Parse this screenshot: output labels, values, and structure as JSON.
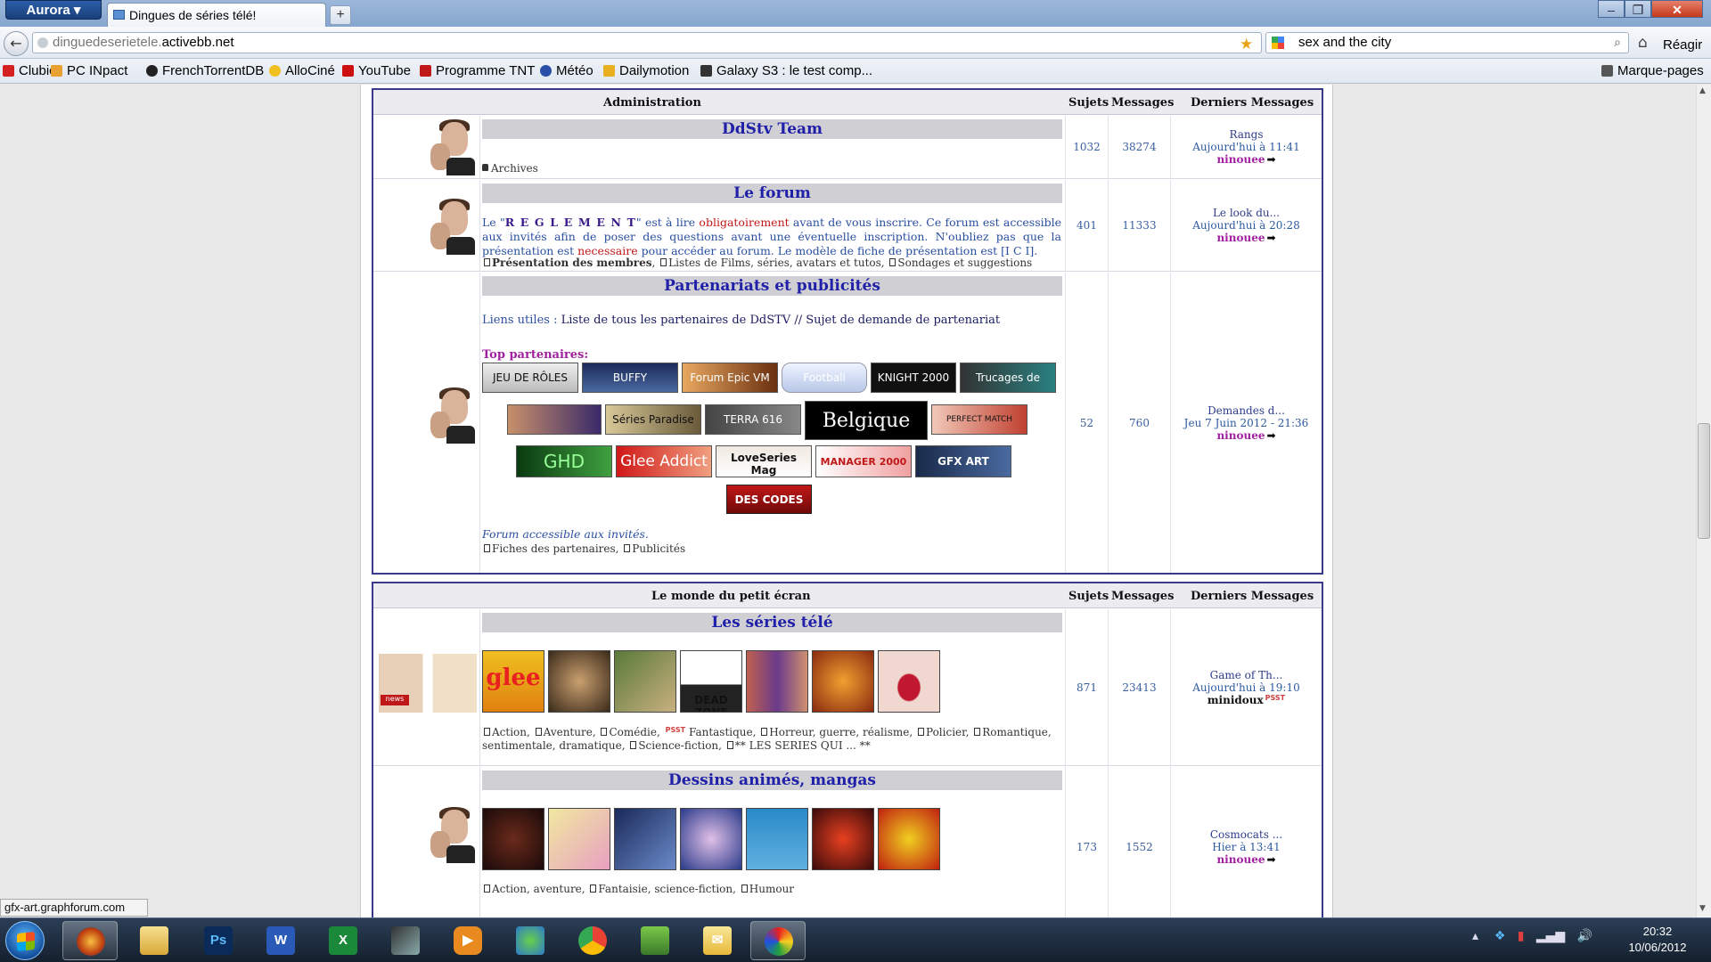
{
  "browser": {
    "app_button": "Aurora",
    "tab_title": "Dingues de séries télé!",
    "new_tab": "+",
    "url_prefix": "dinguedeserietele.",
    "url_host": "activebb.net",
    "search_value": "sex and the city",
    "reagir": "Réagir",
    "bookmarks": [
      "Clubic",
      "PC INpact",
      "FrenchTorrentDB",
      "AlloCiné",
      "YouTube",
      "Programme TNT",
      "Météo",
      "Dailymotion",
      "Galaxy S3 : le test comp..."
    ],
    "bookmarks_menu": "Marque-pages",
    "status_url": "gfx-art.graphforum.com"
  },
  "columns": {
    "sujets": "Sujets",
    "messages": "Messages",
    "derniers": "Derniers Messages"
  },
  "categories": [
    {
      "title": "Administration",
      "forums": [
        {
          "title": "DdStv Team",
          "subforums": [
            "Archives"
          ],
          "sujets": "1032",
          "messages": "38274",
          "last_topic": "Rangs",
          "last_date": "Aujourd'hui à 11:41",
          "last_user": "ninouee"
        },
        {
          "title": "Le forum",
          "desc": {
            "p1": "Le \"",
            "reglement": "R E G L E M E N T",
            "p2": "\" est à lire ",
            "oblig": "obligatoirement",
            "p3": " avant de vous inscrire. Ce forum est accessible aux invités afin de poser des questions avant une éventuelle inscription. N'oubliez pas que la présentation est ",
            "necessaire": "necessaire",
            "p4": " pour accéder au forum. Le modèle de fiche de présentation est [I C I]."
          },
          "subforums": [
            "Présentation des membres",
            "Listes de Films, séries, avatars et tutos",
            "Sondages et suggestions"
          ],
          "sujets": "401",
          "messages": "11333",
          "last_topic": "Le look du...",
          "last_date": "Aujourd'hui à 20:28",
          "last_user": "ninouee"
        },
        {
          "title": "Partenariats et publicités",
          "liens_label": "Liens utiles : ",
          "liens_text": "Liste de tous les partenaires de DdSTV // Sujet de demande de partenariat",
          "top_label": "Top partenaires:",
          "banners": [
            "JEU DE RÔLES",
            "BUFFY",
            "Forum Epic VM",
            "Football",
            "KNIGHT 2000",
            "Trucages de",
            "",
            "Séries Paradise",
            "TERRA 616",
            "Belgique",
            "PERFECT MATCH",
            "GHD",
            "Glee Addict",
            "LoveSeries Mag",
            "MANAGER 2000",
            "GFX ART",
            "DES CODES"
          ],
          "access_note": "Forum accessible aux invités.",
          "subforums": [
            "Fiches des partenaires",
            "Publicités"
          ],
          "sujets": "52",
          "messages": "760",
          "last_topic": "Demandes d...",
          "last_date": "Jeu 7 Juin 2012 - 21:36",
          "last_user": "ninouee"
        }
      ]
    },
    {
      "title": "Le monde du petit écran",
      "forums": [
        {
          "title": "Les séries télé",
          "thumbs": [
            "glee",
            "",
            "",
            "DEAD ZONE",
            "",
            "",
            ""
          ],
          "subforums": [
            "Action",
            "Aventure",
            "Comédie",
            "Fantastique",
            "Horreur, guerre, réalisme",
            "Policier",
            "Romantique, sentimentale, dramatique",
            "Science-fiction",
            "** LES SERIES QUI ... **"
          ],
          "psst": "PSST",
          "sujets": "871",
          "messages": "23413",
          "last_topic": "Game of Th...",
          "last_date": "Aujourd'hui à 19:10",
          "last_user": "minidoux"
        },
        {
          "title": "Dessins animés, mangas",
          "subforums": [
            "Action, aventure",
            "Fantaisie, science-fiction",
            "Humour"
          ],
          "sujets": "173",
          "messages": "1552",
          "last_topic": "Cosmocats ...",
          "last_date": "Hier à 13:41",
          "last_user": "ninouee"
        }
      ]
    }
  ],
  "taskbar": {
    "time": "20:32",
    "date": "10/06/2012"
  },
  "colors": {
    "category_border": "#3a3a8c",
    "forum_title": "#2020a8",
    "user_link": "#a020a0"
  }
}
